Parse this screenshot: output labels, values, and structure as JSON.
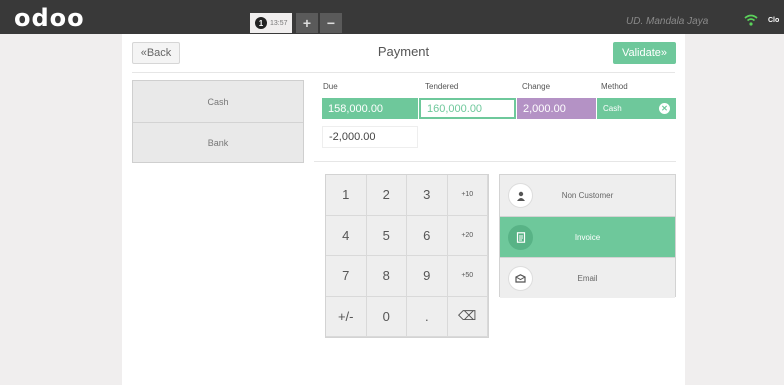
{
  "topbar": {
    "logo": "odoo",
    "order": {
      "number": "1",
      "time": "13:57"
    },
    "add_label": "+",
    "remove_label": "−",
    "company": "UD. Mandala Jaya",
    "close_label": "Clo"
  },
  "header": {
    "back_label": "«Back",
    "title": "Payment",
    "validate_label": "Validate»"
  },
  "methods": [
    {
      "label": "Cash"
    },
    {
      "label": "Bank"
    }
  ],
  "columns": {
    "due": "Due",
    "tendered": "Tendered",
    "change": "Change",
    "method": "Method"
  },
  "payment_line": {
    "due": "158,000.00",
    "tendered": "160,000.00",
    "change": "2,000.00",
    "method": "Cash"
  },
  "remaining": "-2,000.00",
  "numpad": [
    "1",
    "2",
    "3",
    "+10",
    "4",
    "5",
    "6",
    "+20",
    "7",
    "8",
    "9",
    "+50",
    "+/-",
    "0",
    ".",
    "⌫"
  ],
  "actions": [
    {
      "label": "Non Customer",
      "icon": "user-icon",
      "active": false
    },
    {
      "label": "Invoice",
      "icon": "invoice-icon",
      "active": true
    },
    {
      "label": "Email",
      "icon": "email-icon",
      "active": false
    }
  ],
  "colors": {
    "accent": "#6ec89b",
    "change": "#b492c5",
    "topbar": "#393939"
  }
}
